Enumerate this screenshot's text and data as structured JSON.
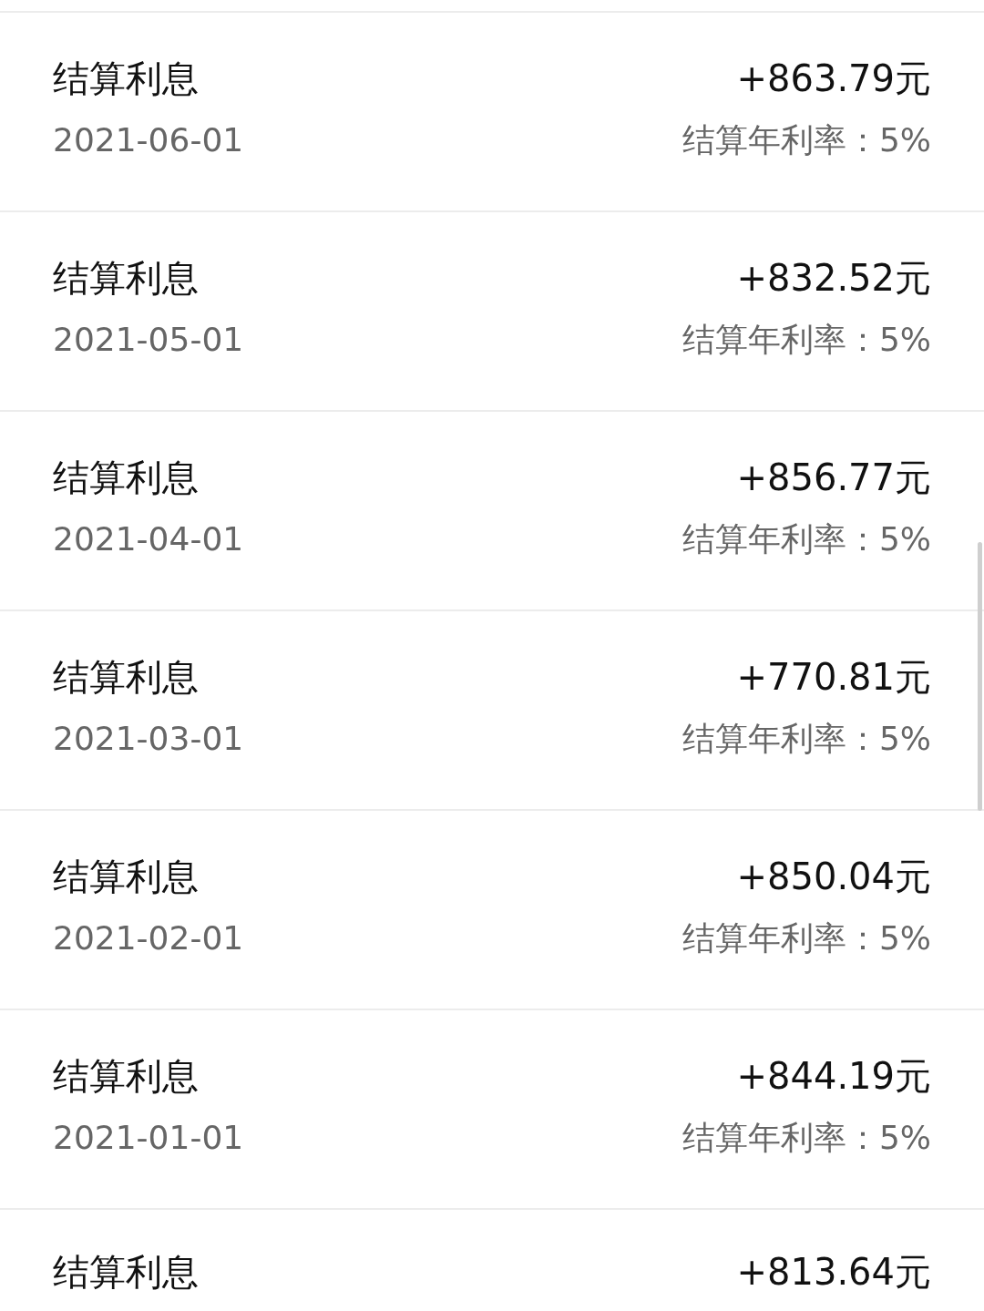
{
  "records": [
    {
      "title": "结算利息",
      "amount": "+863.79元",
      "date": "2021-06-01",
      "rate": "结算年利率：5%"
    },
    {
      "title": "结算利息",
      "amount": "+832.52元",
      "date": "2021-05-01",
      "rate": "结算年利率：5%"
    },
    {
      "title": "结算利息",
      "amount": "+856.77元",
      "date": "2021-04-01",
      "rate": "结算年利率：5%"
    },
    {
      "title": "结算利息",
      "amount": "+770.81元",
      "date": "2021-03-01",
      "rate": "结算年利率：5%"
    },
    {
      "title": "结算利息",
      "amount": "+850.04元",
      "date": "2021-02-01",
      "rate": "结算年利率：5%"
    },
    {
      "title": "结算利息",
      "amount": "+844.19元",
      "date": "2021-01-01",
      "rate": "结算年利率：5%"
    },
    {
      "title": "结算利息",
      "amount": "+813.64元"
    }
  ]
}
